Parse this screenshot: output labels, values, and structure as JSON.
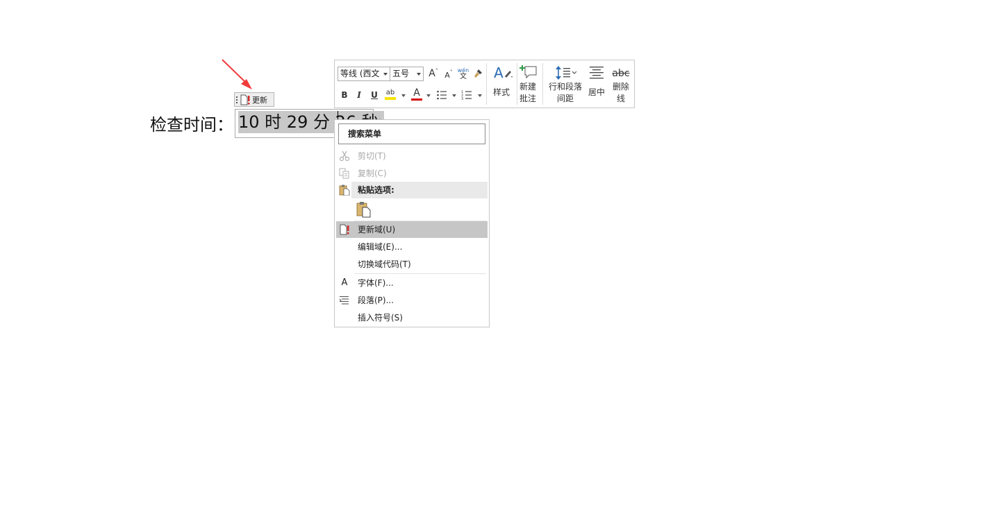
{
  "document": {
    "label": "检查时间：",
    "field_value": "10 时 29 分 26 秒"
  },
  "update_tab": {
    "label": "更新",
    "icon": "update-field-icon"
  },
  "mini_toolbar": {
    "font_name": "等线 (西文",
    "font_size": "五号",
    "grow_font_icon": "A",
    "shrink_font_icon": "A",
    "phonetic_top": "wén",
    "phonetic_bottom": "文",
    "bold": "B",
    "italic": "I",
    "underline": "U",
    "highlight_icon": "ab",
    "font_color_icon": "A",
    "styles_label": "样式",
    "new_comment_label_1": "新建",
    "new_comment_label_2": "批注",
    "line_spacing_label_1": "行和段落",
    "line_spacing_label_2": "间距",
    "center_label": "居中",
    "strikethrough_icon": "abc",
    "strikethrough_label_1": "删除",
    "strikethrough_label_2": "线",
    "colors": {
      "highlight": "#f5e400",
      "font_color": "#d40000",
      "accent": "#2b6cb3"
    }
  },
  "context_menu": {
    "search_placeholder": "搜索菜单",
    "items": [
      {
        "label": "剪切(T)",
        "icon": "cut-icon",
        "enabled": false
      },
      {
        "label": "复制(C)",
        "icon": "copy-icon",
        "enabled": false
      },
      {
        "label": "粘贴选项:",
        "icon": "paste-icon",
        "header": true
      },
      {
        "label": "更新域(U)",
        "icon": "update-field-icon",
        "highlighted": true
      },
      {
        "label": "编辑域(E)...",
        "icon": ""
      },
      {
        "label": "切换域代码(T)",
        "icon": ""
      },
      {
        "label": "字体(F)...",
        "icon": "font-icon"
      },
      {
        "label": "段落(P)...",
        "icon": "paragraph-icon"
      },
      {
        "label": "插入符号(S)",
        "icon": ""
      }
    ]
  }
}
